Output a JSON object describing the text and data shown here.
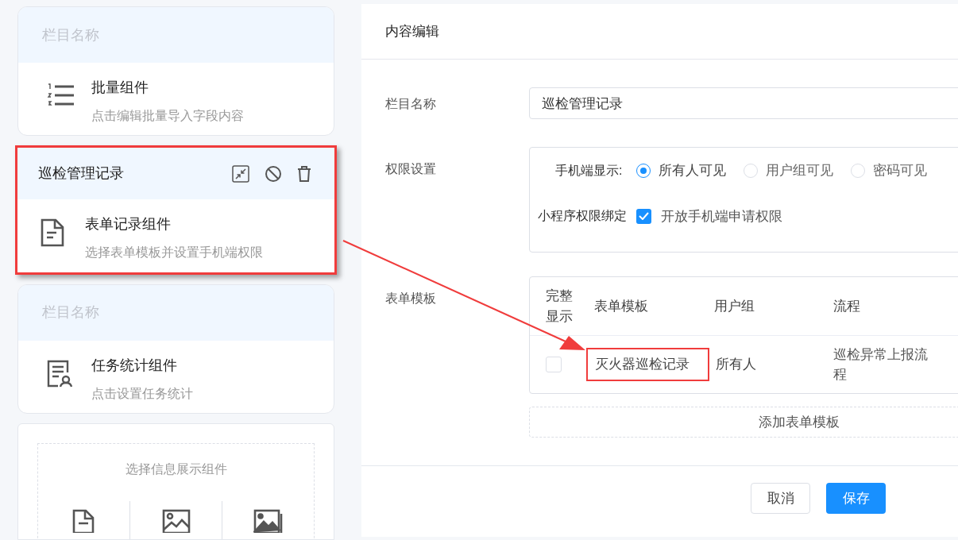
{
  "sidebar": {
    "cards": [
      {
        "kind": "batch",
        "title": "栏目名称",
        "title_is_placeholder": true,
        "selected": false,
        "name": "批量组件",
        "description": "点击编辑批量导入字段内容"
      },
      {
        "kind": "form",
        "title": "巡检管理记录",
        "title_is_placeholder": false,
        "selected": true,
        "name": "表单记录组件",
        "description": "选择表单模板并设置手机端权限"
      },
      {
        "kind": "stats",
        "title": "栏目名称",
        "title_is_placeholder": true,
        "selected": false,
        "name": "任务统计组件",
        "description": "点击设置任务统计"
      },
      {
        "kind": "picker",
        "prompt": "选择信息展示组件"
      }
    ]
  },
  "editor": {
    "title": "内容编辑",
    "fields": [
      {
        "kind": "text",
        "label": "栏目名称",
        "value": "巡检管理记录"
      },
      {
        "kind": "permissions",
        "label": "权限设置",
        "mobile_label": "手机端显示:",
        "radios": [
          {
            "label": "所有人可见",
            "selected": true
          },
          {
            "label": "用户组可见",
            "selected": false
          },
          {
            "label": "密码可见",
            "selected": false
          }
        ],
        "miniapp_label": "小程序权限绑定",
        "checkbox": {
          "label": "开放手机端申请权限",
          "checked": true
        }
      },
      {
        "kind": "table",
        "label": "表单模板",
        "columns": [
          "完整显示",
          "表单模板",
          "用户组",
          "流程"
        ],
        "rows": [
          {
            "full_display": false,
            "template": "灭火器巡检记录",
            "highlighted": true,
            "group": "所有人",
            "flow": "巡检异常上报流程"
          }
        ],
        "add_button": "添加表单模板"
      }
    ],
    "buttons": [
      {
        "kind": "secondary",
        "label": "取消"
      },
      {
        "kind": "primary",
        "label": "保存"
      }
    ]
  },
  "annotation_arrow": true
}
